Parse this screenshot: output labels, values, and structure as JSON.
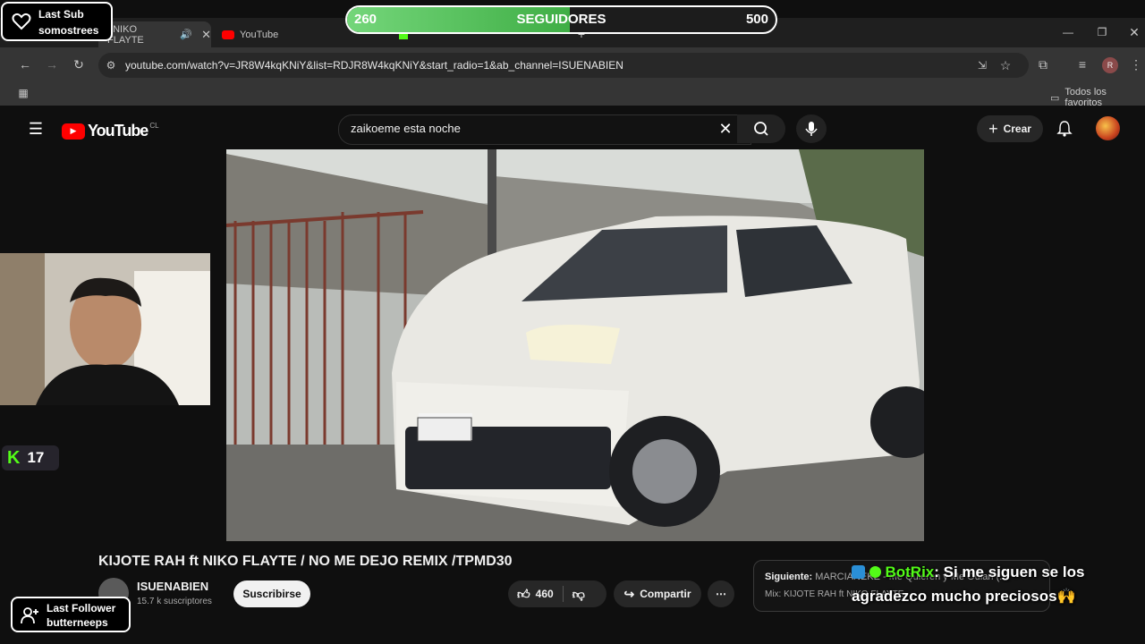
{
  "overlay": {
    "last_sub_title": "Last Sub",
    "last_sub_name": "somostrees",
    "progress_current": "260",
    "progress_label": "SEGUIDORES",
    "progress_goal": "500",
    "progress_fraction": 0.52,
    "kick_count": "17",
    "last_follower_title": "Last Follower",
    "last_follower_name": "butterneeps",
    "chat_user": "BotRix",
    "chat_message": ": Si me siguen se los agradezco mucho preciosos🙌"
  },
  "browser": {
    "tab1_title": "t NIKO FLAYTE",
    "tab2_title": "YouTube",
    "url": "youtube.com/watch?v=JR8W4kqKNiY&list=RDJR8W4kqKNiY&start_radio=1&ab_channel=ISUENABIEN",
    "bookmarks_label": "Todos los favoritos",
    "profile_initial": "R"
  },
  "youtube": {
    "logo_text": "YouTube",
    "country_code": "CL",
    "search_value": "zaikoeme esta noche",
    "create_label": "Crear",
    "video_title": "KIJOTE RAH ft NIKO FLAYTE / NO ME DEJO REMIX /TPMD30",
    "channel_name": "ISUENABIEN",
    "subscribers": "15.7 k suscriptores",
    "subscribe_label": "Suscribirse",
    "likes": "460",
    "share_label": "Compartir",
    "next_label": "Siguiente:",
    "next_title": "MARCIANEKE - Me Quieren y Me Odian (...",
    "next_mix": "Mix: KIJOTE RAH ft NIKO FLAYTE..."
  },
  "colors": {
    "progress_green": "#5cc45a",
    "kick_green": "#53fc18",
    "youtube_red": "#ff0000"
  }
}
